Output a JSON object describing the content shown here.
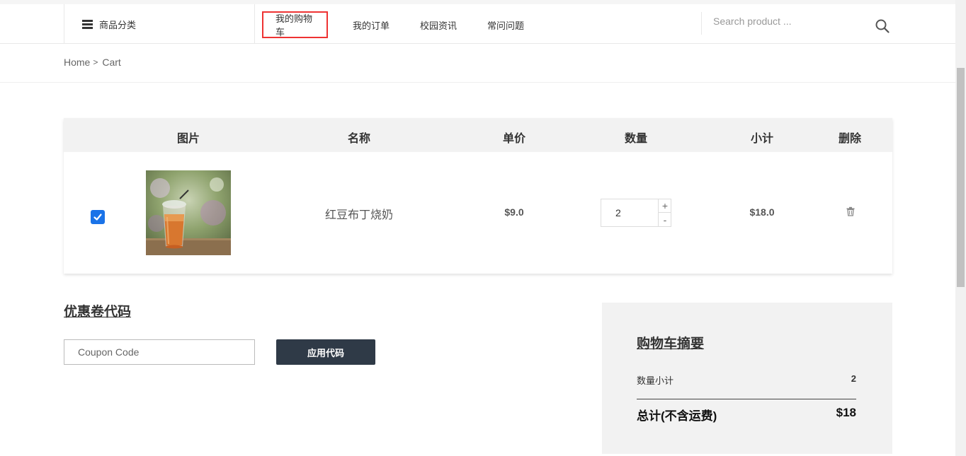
{
  "header": {
    "category_label": "商品分类",
    "nav": [
      {
        "label": "我的购物车",
        "active": true
      },
      {
        "label": "我的订单"
      },
      {
        "label": "校园资讯"
      },
      {
        "label": "常问问题"
      }
    ],
    "search_placeholder": "Search product ..."
  },
  "breadcrumb": {
    "home": "Home",
    "separator": ">",
    "current": "Cart"
  },
  "cart": {
    "columns": [
      "图片",
      "名称",
      "单价",
      "数量",
      "小计",
      "删除"
    ],
    "items": [
      {
        "checked": true,
        "image_alt": "iced milk tea cup",
        "name": "红豆布丁烧奶",
        "price": "$9.0",
        "quantity": "2",
        "plus": "+",
        "minus": "-",
        "subtotal": "$18.0",
        "delete_icon": "trash-icon"
      }
    ]
  },
  "coupon": {
    "title": "优惠卷代码",
    "placeholder": "Coupon Code",
    "apply_label": "应用代码"
  },
  "summary": {
    "title": "购物车摘要",
    "qty_label": "数量小计",
    "qty_value": "2",
    "total_label": "总计(不含运费)",
    "total_value": "$18"
  },
  "colors": {
    "active_nav_border": "#e33333",
    "checkbox": "#1a73e8",
    "apply_button": "#2f3a47",
    "table_header_bg": "#f2f2f2"
  }
}
